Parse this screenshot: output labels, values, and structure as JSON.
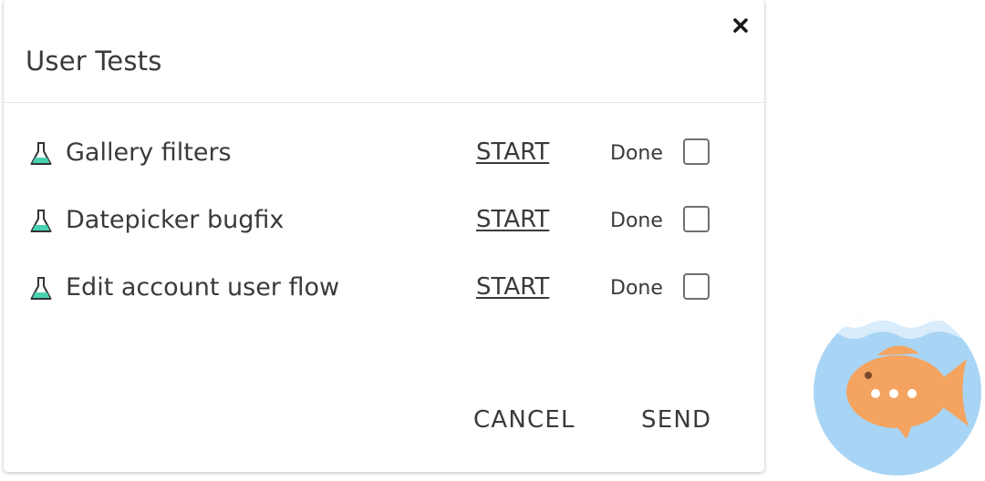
{
  "dialog": {
    "title": "User Tests",
    "close_icon": "close-icon"
  },
  "tests": [
    {
      "name": "Gallery filters",
      "action_label": "START",
      "done_label": "Done",
      "done": false,
      "icon": "flask-icon"
    },
    {
      "name": "Datepicker bugfix",
      "action_label": "START",
      "done_label": "Done",
      "done": false,
      "icon": "flask-icon"
    },
    {
      "name": "Edit account user flow",
      "action_label": "START",
      "done_label": "Done",
      "done": false,
      "icon": "flask-icon"
    }
  ],
  "footer": {
    "cancel_label": "CANCEL",
    "send_label": "SEND"
  },
  "chat_launcher": {
    "icon": "fish-chat-icon",
    "colors": {
      "bowl": "#a8d4f5",
      "water_top": "#d8ecfb",
      "fish": "#f4a460"
    }
  },
  "colors": {
    "flask_liquid": "#48d1b0",
    "text": "#3a3a3a",
    "checkbox_border": "#6f6f6f"
  }
}
